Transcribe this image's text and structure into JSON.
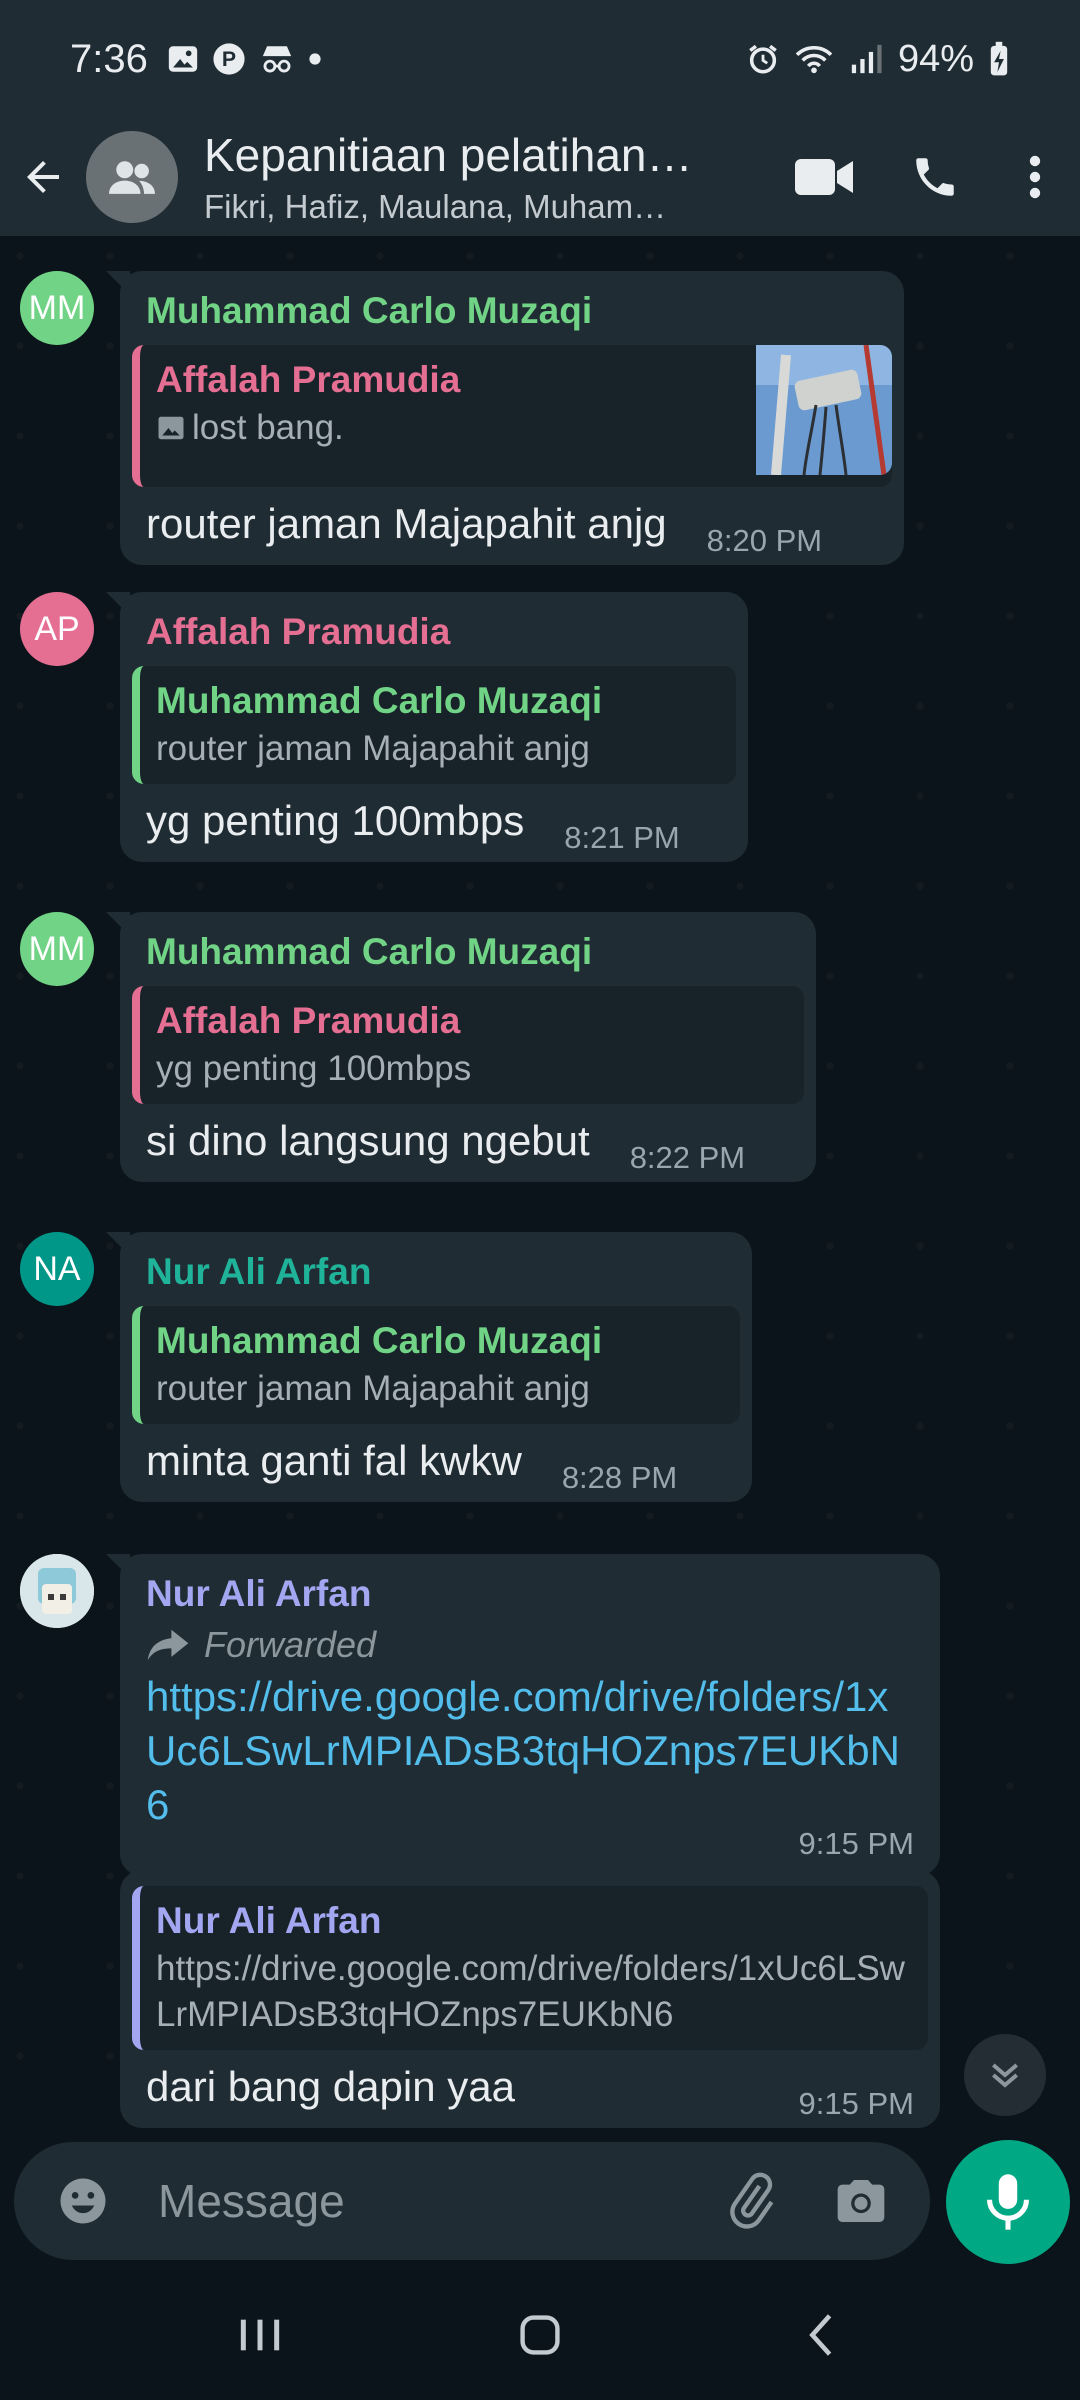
{
  "status_bar": {
    "time": "7:36",
    "battery": "94%",
    "icons": [
      "gallery-icon",
      "pinterest-icon",
      "incognito-icon",
      "dot-icon",
      "alarm-icon",
      "wifi-icon",
      "signal-icon",
      "battery-charging-icon"
    ]
  },
  "header": {
    "title": "Kepanitiaan pelatihan…",
    "subtitle": "Fikri, Hafiz, Maulana, Muham…",
    "icons": [
      "back-arrow-icon",
      "group-icon",
      "video-call-icon",
      "phone-icon",
      "more-vert-icon"
    ]
  },
  "colors": {
    "green_name": "#71d385",
    "pink_name": "#e56f93",
    "teal_name": "#1fb39a",
    "purple_name": "#a3a6f0",
    "accent": "#00a884",
    "link": "#53bdeb"
  },
  "messages": [
    {
      "avatar": "MM",
      "sender": "Muhammad Carlo Muzaqi",
      "quote_name": "Affalah Pramudia",
      "quote_text": "lost bang.",
      "text": "router jaman Majapahit anjg",
      "time": "8:20 PM"
    },
    {
      "avatar": "AP",
      "sender": "Affalah Pramudia",
      "quote_name": "Muhammad Carlo Muzaqi",
      "quote_text": "router jaman Majapahit anjg",
      "text": "yg penting 100mbps",
      "time": "8:21 PM"
    },
    {
      "avatar": "MM",
      "sender": "Muhammad Carlo Muzaqi",
      "quote_name": "Affalah Pramudia",
      "quote_text": "yg penting 100mbps",
      "text": "si dino langsung ngebut",
      "time": "8:22 PM"
    },
    {
      "avatar": "NA",
      "sender": "Nur Ali Arfan",
      "quote_name": "Muhammad Carlo Muzaqi",
      "quote_text": "router jaman Majapahit anjg",
      "text": "minta ganti fal kwkw",
      "time": "8:28 PM"
    },
    {
      "sender": "Nur Ali Arfan",
      "forwarded": "Forwarded",
      "link": "https://drive.google.com/drive/folders/1xUc6LSwLrMPIADsB3tqHOZnps7EUKbN6",
      "time": "9:15 PM"
    },
    {
      "quote_name": "Nur Ali Arfan",
      "quote_text": "https://drive.google.com/drive/folders/1xUc6LSwLrMPIADsB3tqHOZnps7EUKbN6",
      "text": "dari bang dapin yaa",
      "time": "9:15 PM"
    }
  ],
  "composer": {
    "placeholder": "Message",
    "icons": [
      "emoji-icon",
      "attach-icon",
      "camera-icon",
      "mic-icon"
    ]
  },
  "navbar": {
    "icons": [
      "recents-icon",
      "home-icon",
      "back-icon"
    ]
  }
}
